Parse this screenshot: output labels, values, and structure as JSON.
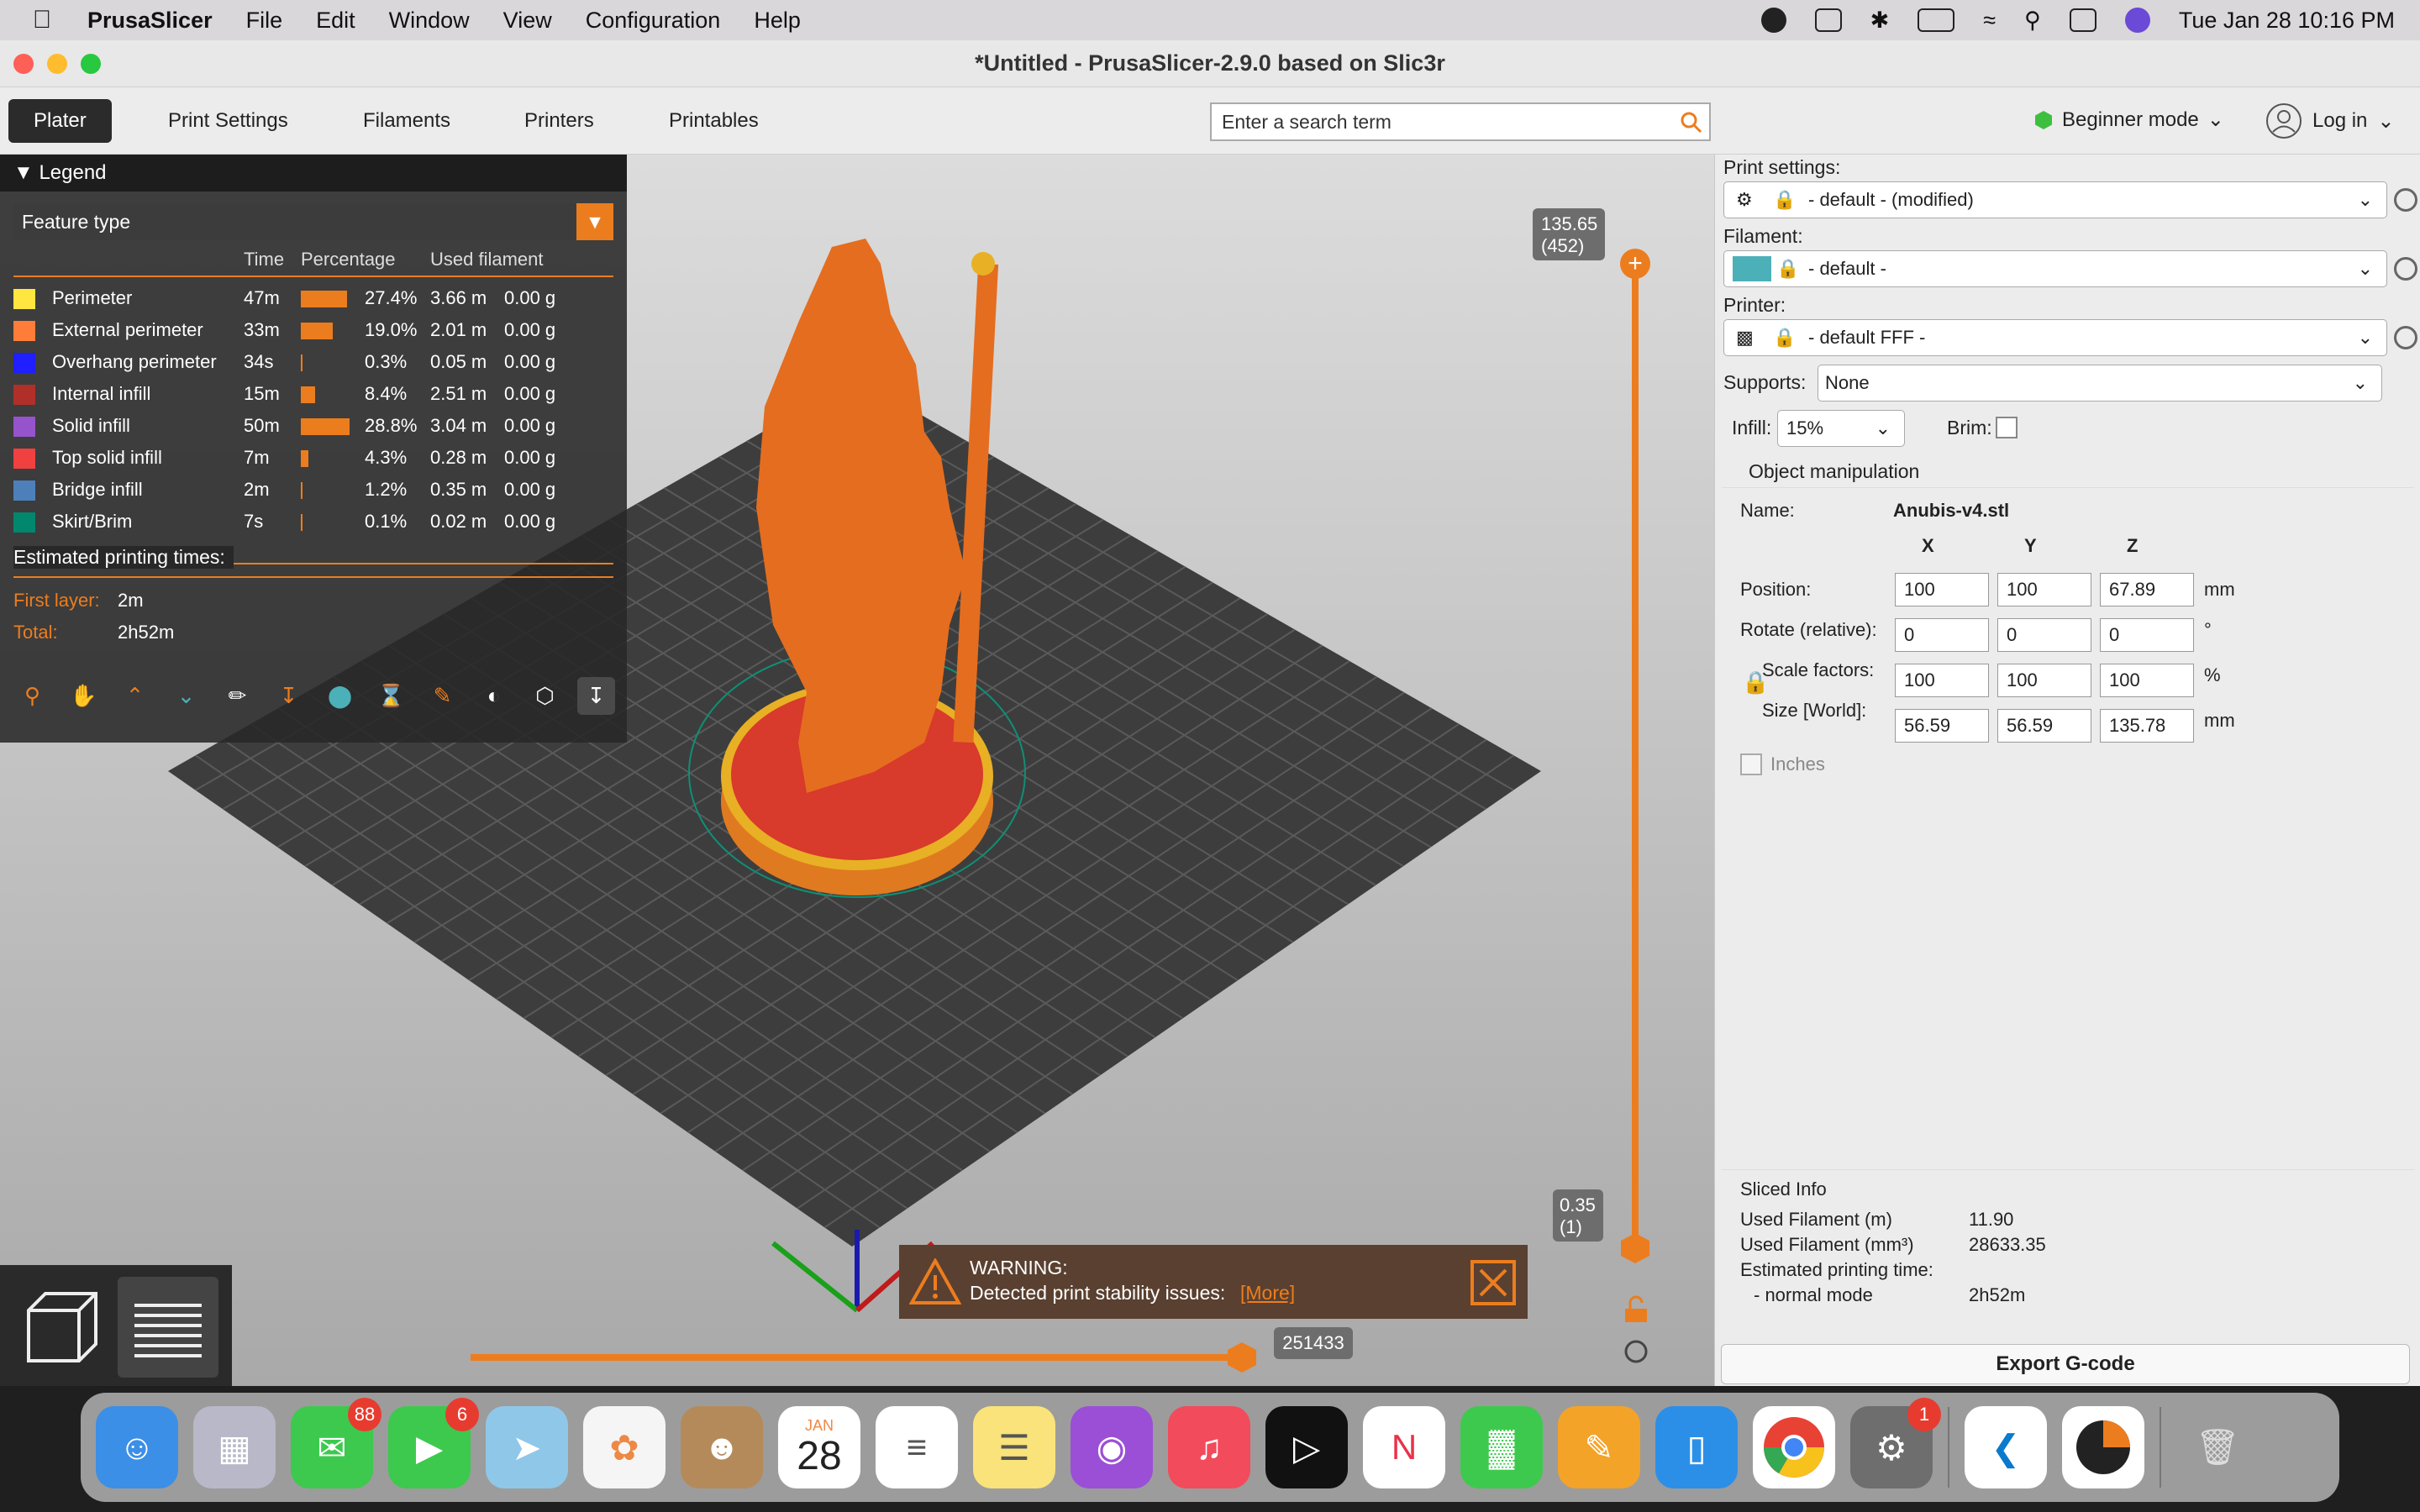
{
  "menubar": {
    "app": "PrusaSlicer",
    "items": [
      "File",
      "Edit",
      "Window",
      "View",
      "Configuration",
      "Help"
    ],
    "clock": "Tue Jan 28  10:16 PM"
  },
  "window": {
    "title": "*Untitled - PrusaSlicer-2.9.0 based on Slic3r"
  },
  "tabs": [
    "Plater",
    "Print Settings",
    "Filaments",
    "Printers",
    "Printables"
  ],
  "search": {
    "placeholder": "Enter a search term"
  },
  "mode": {
    "label": "Beginner mode",
    "color": "#3fbf3f"
  },
  "login": {
    "label": "Log in"
  },
  "legend": {
    "title": "Legend",
    "view_type": "Feature type",
    "columns": {
      "time": "Time",
      "percentage": "Percentage",
      "used": "Used filament"
    },
    "rows": [
      {
        "name": "Perimeter",
        "time": "47m",
        "pct": "27.4%",
        "len": "3.66 m",
        "wt": "0.00 g",
        "color": "#ffe640",
        "frac": 0.274
      },
      {
        "name": "External perimeter",
        "time": "33m",
        "pct": "19.0%",
        "len": "2.01 m",
        "wt": "0.00 g",
        "color": "#ff7d38",
        "frac": 0.19
      },
      {
        "name": "Overhang perimeter",
        "time": "34s",
        "pct": "0.3%",
        "len": "0.05 m",
        "wt": "0.00 g",
        "color": "#1f1fff",
        "frac": 0.003
      },
      {
        "name": "Internal infill",
        "time": "15m",
        "pct": "8.4%",
        "len": "2.51 m",
        "wt": "0.00 g",
        "color": "#b03029",
        "frac": 0.084
      },
      {
        "name": "Solid infill",
        "time": "50m",
        "pct": "28.8%",
        "len": "3.04 m",
        "wt": "0.00 g",
        "color": "#9654cc",
        "frac": 0.288
      },
      {
        "name": "Top solid infill",
        "time": "7m",
        "pct": "4.3%",
        "len": "0.28 m",
        "wt": "0.00 g",
        "color": "#f04040",
        "frac": 0.043
      },
      {
        "name": "Bridge infill",
        "time": "2m",
        "pct": "1.2%",
        "len": "0.35 m",
        "wt": "0.00 g",
        "color": "#4d80ba",
        "frac": 0.012
      },
      {
        "name": "Skirt/Brim",
        "time": "7s",
        "pct": "0.1%",
        "len": "0.02 m",
        "wt": "0.00 g",
        "color": "#00876e",
        "frac": 0.001
      }
    ],
    "est_label": "Estimated printing times:",
    "first_layer_label": "First layer:",
    "first_layer": "2m",
    "total_label": "Total:",
    "total": "2h52m"
  },
  "vslider": {
    "top_value": "135.65",
    "top_layer": "(452)",
    "bottom_value": "0.35",
    "bottom_layer": "(1)"
  },
  "hslider": {
    "value": "251433"
  },
  "warning": {
    "title": "WARNING:",
    "text": "Detected print stability issues:",
    "link": "[More]"
  },
  "print_settings": {
    "label": "Print settings:",
    "value": "- default - (modified)",
    "filament_label": "Filament:",
    "filament_value": "- default -",
    "filament_color": "#4bb0b8",
    "printer_label": "Printer:",
    "printer_value": "- default FFF -",
    "supports_label": "Supports:",
    "supports_value": "None",
    "infill_label": "Infill:",
    "infill_value": "15%",
    "brim_label": "Brim:"
  },
  "object": {
    "section": "Object manipulation",
    "name_label": "Name:",
    "name": "Anubis-v4.stl",
    "axes": [
      "X",
      "Y",
      "Z"
    ],
    "position_label": "Position:",
    "position": [
      "100",
      "100",
      "67.89"
    ],
    "position_unit": "mm",
    "rotate_label": "Rotate (relative):",
    "rotate": [
      "0",
      "0",
      "0"
    ],
    "rotate_unit": "°",
    "scale_label": "Scale factors:",
    "scale": [
      "100",
      "100",
      "100"
    ],
    "scale_unit": "%",
    "size_label": "Size [World]:",
    "size": [
      "56.59",
      "56.59",
      "135.78"
    ],
    "size_unit": "mm",
    "inches_label": "Inches"
  },
  "sliced": {
    "title": "Sliced Info",
    "used_m_label": "Used Filament (m)",
    "used_m": "11.90",
    "used_mm3_label": "Used Filament (mm³)",
    "used_mm3": "28633.35",
    "est_label": "Estimated printing time:",
    "mode_label": "- normal mode",
    "mode_time": "2h52m"
  },
  "export_label": "Export G-code",
  "dock": {
    "messages_badge": "88",
    "facetime_badge": "6",
    "calendar_month": "JAN",
    "calendar_day": "28",
    "settings_badge": "1"
  }
}
